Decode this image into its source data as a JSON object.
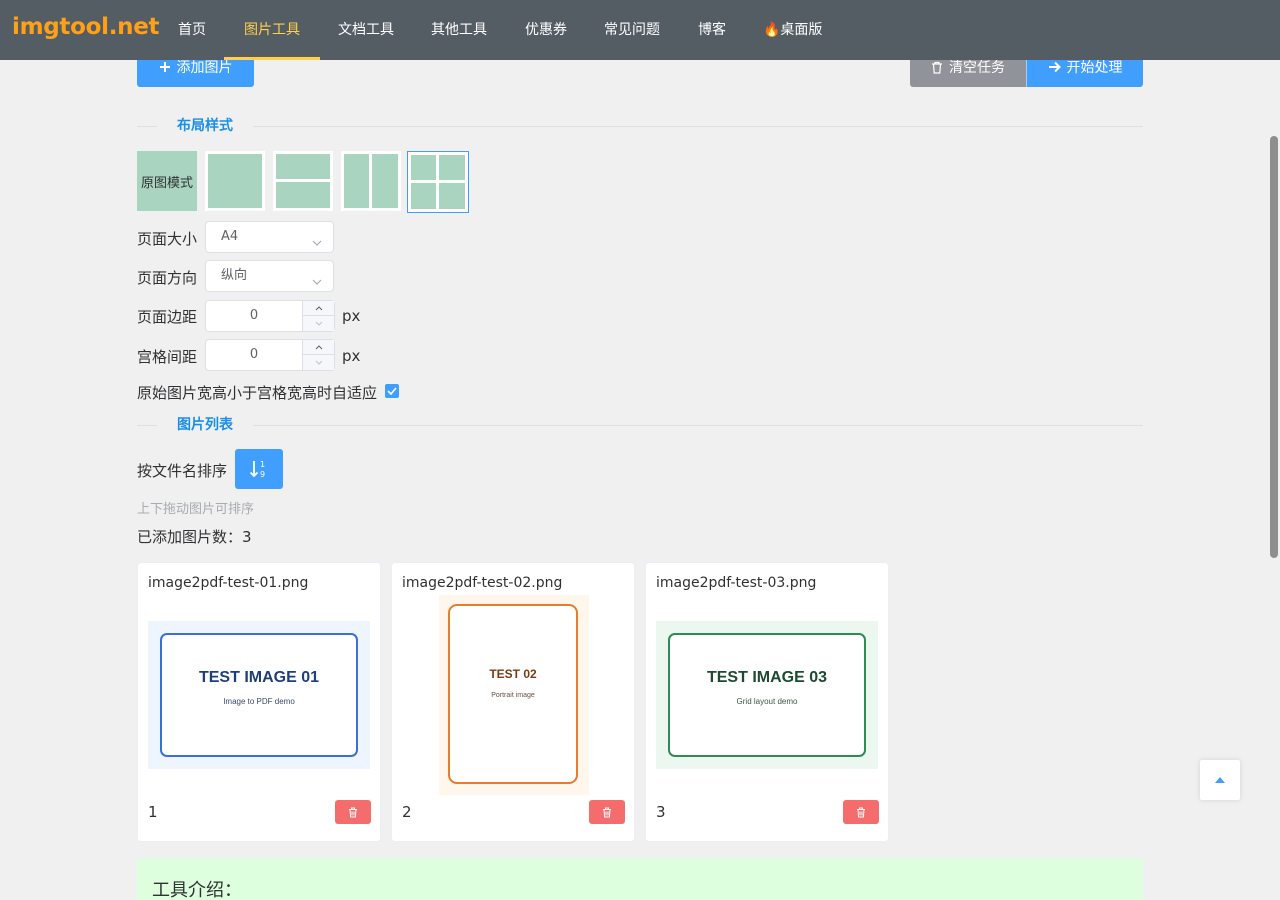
{
  "nav": {
    "logo": "imgtool.net",
    "items": [
      {
        "label": "首页"
      },
      {
        "label": "图片工具"
      },
      {
        "label": "文档工具"
      },
      {
        "label": "其他工具"
      },
      {
        "label": "优惠券"
      },
      {
        "label": "常见问题"
      },
      {
        "label": "博客"
      },
      {
        "label": "🔥桌面版"
      }
    ],
    "active": "图片工具"
  },
  "toolbar": {
    "add_label": "添加图片",
    "clear_label": "清空任务",
    "start_label": "开始处理"
  },
  "layout_section": {
    "title": "布局样式",
    "original_label": "原图模式",
    "options": [
      "原图模式",
      "单格",
      "上下两格",
      "左右两格",
      "四宫格"
    ],
    "selected": "四宫格"
  },
  "form": {
    "page_size_label": "页面大小",
    "page_size_value": "A4",
    "orientation_label": "页面方向",
    "orientation_value": "纵向",
    "margin_label": "页面边距",
    "margin_value": "0",
    "margin_unit": "px",
    "gap_label": "宫格间距",
    "gap_value": "0",
    "gap_unit": "px",
    "adapt_label": "原始图片宽高小于宫格宽高时自适应",
    "adapt_checked": true
  },
  "image_list": {
    "title": "图片列表",
    "sort_label": "按文件名排序",
    "drag_hint": "上下拖动图片可排序",
    "count_label": "已添加图片数：3",
    "items": [
      {
        "filename": "image2pdf-test-01.png",
        "index": "1",
        "title": "TEST IMAGE 01",
        "subtitle": "Image to PDF demo"
      },
      {
        "filename": "image2pdf-test-02.png",
        "index": "2",
        "title": "TEST 02",
        "subtitle": "Portrait image"
      },
      {
        "filename": "image2pdf-test-03.png",
        "index": "3",
        "title": "TEST IMAGE 03",
        "subtitle": "Grid layout demo"
      }
    ]
  },
  "intro": {
    "title": "工具介绍："
  },
  "colors": {
    "nav_bg": "#545c64",
    "accent": "#409eff",
    "logo": "#ffa116",
    "danger": "#f56c6c"
  }
}
